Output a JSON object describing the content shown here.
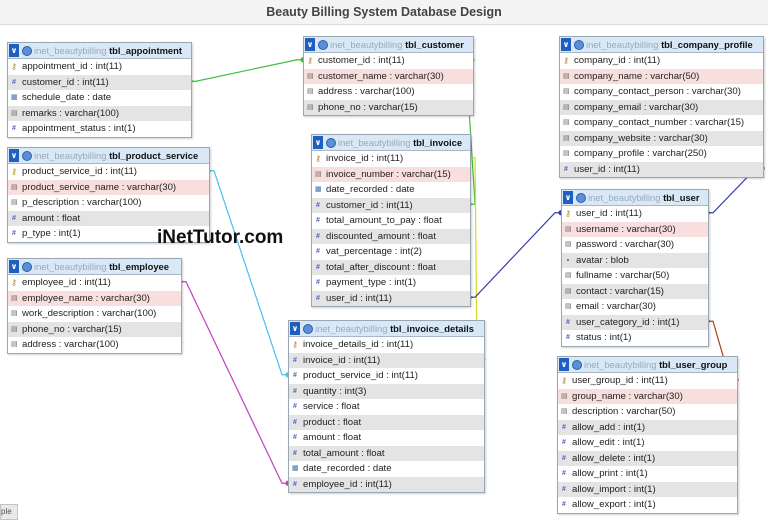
{
  "title": "Beauty Billing System Database Design",
  "watermark": "iNetTutor.com",
  "corner_tab": "ple",
  "tables": [
    {
      "id": "tbl_appointment",
      "db": "inet_beautybilling",
      "name": "tbl_appointment",
      "fields": [
        {
          "text": "appointment_id : int(11)",
          "icon": "key"
        },
        {
          "text": "customer_id : int(11)",
          "icon": "hash"
        },
        {
          "text": "schedule_date : date",
          "icon": "date"
        },
        {
          "text": "remarks : varchar(100)",
          "icon": "text"
        },
        {
          "text": "appointment_status : int(1)",
          "icon": "hash"
        }
      ]
    },
    {
      "id": "tbl_customer",
      "db": "inet_beautybilling",
      "name": "tbl_customer",
      "fields": [
        {
          "text": "customer_id : int(11)",
          "icon": "key"
        },
        {
          "text": "customer_name : varchar(30)",
          "icon": "text"
        },
        {
          "text": "address : varchar(100)",
          "icon": "text"
        },
        {
          "text": "phone_no : varchar(15)",
          "icon": "text"
        }
      ]
    },
    {
      "id": "tbl_company_profile",
      "db": "inet_beautybilling",
      "name": "tbl_company_profile",
      "fields": [
        {
          "text": "company_id : int(11)",
          "icon": "key"
        },
        {
          "text": "company_name : varchar(50)",
          "icon": "text"
        },
        {
          "text": "company_contact_person : varchar(30)",
          "icon": "text"
        },
        {
          "text": "company_email : varchar(30)",
          "icon": "text"
        },
        {
          "text": "company_contact_number : varchar(15)",
          "icon": "text"
        },
        {
          "text": "company_website : varchar(30)",
          "icon": "text"
        },
        {
          "text": "company_profile : varchar(250)",
          "icon": "text"
        },
        {
          "text": "user_id : int(11)",
          "icon": "hash"
        }
      ]
    },
    {
      "id": "tbl_product_service",
      "db": "inet_beautybilling",
      "name": "tbl_product_service",
      "fields": [
        {
          "text": "product_service_id : int(11)",
          "icon": "key"
        },
        {
          "text": "product_service_name : varchar(30)",
          "icon": "text"
        },
        {
          "text": "p_description : varchar(100)",
          "icon": "text"
        },
        {
          "text": "amount : float",
          "icon": "hash"
        },
        {
          "text": "p_type : int(1)",
          "icon": "hash"
        }
      ]
    },
    {
      "id": "tbl_invoice",
      "db": "inet_beautybilling",
      "name": "tbl_invoice",
      "fields": [
        {
          "text": "invoice_id : int(11)",
          "icon": "key"
        },
        {
          "text": "invoice_number : varchar(15)",
          "icon": "text"
        },
        {
          "text": "date_recorded : date",
          "icon": "date"
        },
        {
          "text": "customer_id : int(11)",
          "icon": "hash"
        },
        {
          "text": "total_amount_to_pay : float",
          "icon": "hash"
        },
        {
          "text": "discounted_amount : float",
          "icon": "hash"
        },
        {
          "text": "vat_percentage : int(2)",
          "icon": "hash"
        },
        {
          "text": "total_after_discount : float",
          "icon": "hash"
        },
        {
          "text": "payment_type : int(1)",
          "icon": "hash"
        },
        {
          "text": "user_id : int(11)",
          "icon": "hash"
        }
      ]
    },
    {
      "id": "tbl_user",
      "db": "inet_beautybilling",
      "name": "tbl_user",
      "fields": [
        {
          "text": "user_id : int(11)",
          "icon": "key"
        },
        {
          "text": "username : varchar(30)",
          "icon": "text"
        },
        {
          "text": "password : varchar(30)",
          "icon": "text"
        },
        {
          "text": "avatar : blob",
          "icon": "blob"
        },
        {
          "text": "fullname : varchar(50)",
          "icon": "text"
        },
        {
          "text": "contact : varchar(15)",
          "icon": "text"
        },
        {
          "text": "email : varchar(30)",
          "icon": "text"
        },
        {
          "text": "user_category_id : int(1)",
          "icon": "hash"
        },
        {
          "text": "status : int(1)",
          "icon": "hash"
        }
      ]
    },
    {
      "id": "tbl_employee",
      "db": "inet_beautybilling",
      "name": "tbl_employee",
      "fields": [
        {
          "text": "employee_id : int(11)",
          "icon": "key"
        },
        {
          "text": "employee_name : varchar(30)",
          "icon": "text"
        },
        {
          "text": "work_description : varchar(100)",
          "icon": "text"
        },
        {
          "text": "phone_no : varchar(15)",
          "icon": "text"
        },
        {
          "text": "address : varchar(100)",
          "icon": "text"
        }
      ]
    },
    {
      "id": "tbl_invoice_details",
      "db": "inet_beautybilling",
      "name": "tbl_invoice_details",
      "fields": [
        {
          "text": "invoice_details_id : int(11)",
          "icon": "key"
        },
        {
          "text": "invoice_id : int(11)",
          "icon": "hash"
        },
        {
          "text": "product_service_id : int(11)",
          "icon": "hash"
        },
        {
          "text": "quantity : int(3)",
          "icon": "hash"
        },
        {
          "text": "service : float",
          "icon": "hash"
        },
        {
          "text": "product : float",
          "icon": "hash"
        },
        {
          "text": "amount : float",
          "icon": "hash"
        },
        {
          "text": "total_amount : float",
          "icon": "hash"
        },
        {
          "text": "date_recorded : date",
          "icon": "date"
        },
        {
          "text": "employee_id : int(11)",
          "icon": "hash"
        }
      ]
    },
    {
      "id": "tbl_user_group",
      "db": "inet_beautybilling",
      "name": "tbl_user_group",
      "fields": [
        {
          "text": "user_group_id : int(11)",
          "icon": "key"
        },
        {
          "text": "group_name : varchar(30)",
          "icon": "text"
        },
        {
          "text": "description : varchar(50)",
          "icon": "text"
        },
        {
          "text": "allow_add : int(1)",
          "icon": "hash"
        },
        {
          "text": "allow_edit : int(1)",
          "icon": "hash"
        },
        {
          "text": "allow_delete : int(1)",
          "icon": "hash"
        },
        {
          "text": "allow_print : int(1)",
          "icon": "hash"
        },
        {
          "text": "allow_import : int(1)",
          "icon": "hash"
        },
        {
          "text": "allow_export : int(1)",
          "icon": "hash"
        }
      ]
    }
  ],
  "relations": [
    {
      "from": "tbl_appointment.customer_id",
      "to": "tbl_customer.customer_id",
      "color": "#3cbf3c"
    },
    {
      "from": "tbl_invoice.customer_id",
      "to": "tbl_customer.customer_id",
      "color": "#3cbf3c"
    },
    {
      "from": "tbl_invoice_details.invoice_id",
      "to": "tbl_invoice.invoice_id",
      "color": "#d8d820"
    },
    {
      "from": "tbl_invoice_details.product_service_id",
      "to": "tbl_product_service.product_service_id",
      "color": "#4cc3e6"
    },
    {
      "from": "tbl_invoice_details.employee_id",
      "to": "tbl_employee.employee_id",
      "color": "#c040c0"
    },
    {
      "from": "tbl_invoice.user_id",
      "to": "tbl_user.user_id",
      "color": "#3b3bb0"
    },
    {
      "from": "tbl_company_profile.user_id",
      "to": "tbl_user.user_id",
      "color": "#3b3bb0"
    },
    {
      "from": "tbl_user.user_category_id",
      "to": "tbl_user_group.user_group_id",
      "color": "#b03a1f"
    }
  ]
}
